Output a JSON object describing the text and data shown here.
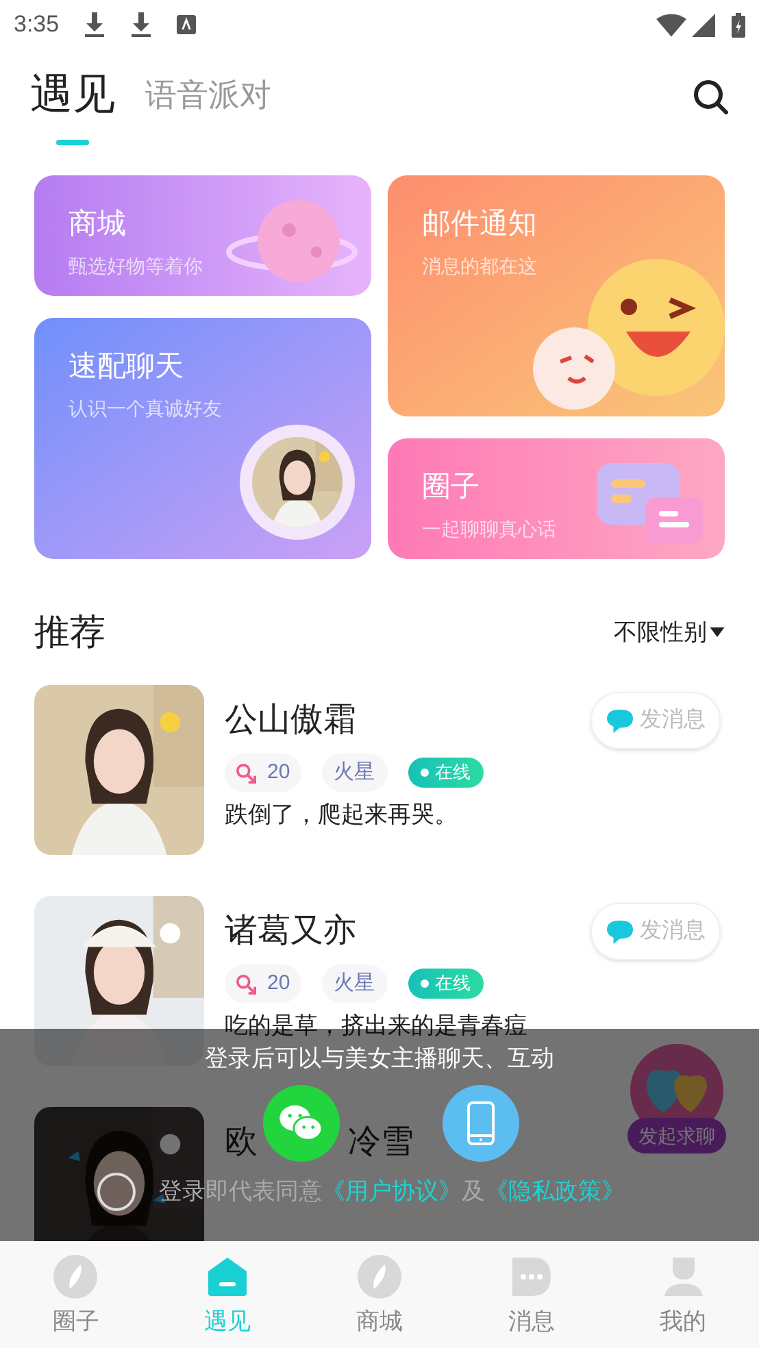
{
  "status_bar": {
    "time": "3:35"
  },
  "header": {
    "tabs": [
      {
        "label": "遇见",
        "selected": true
      },
      {
        "label": "语音派对",
        "selected": false
      }
    ]
  },
  "feature_cards": [
    {
      "kind": "shop",
      "title": "商城",
      "subtitle": "甄选好物等着你"
    },
    {
      "kind": "match",
      "title": "速配聊天",
      "subtitle": "认识一个真诚好友"
    },
    {
      "kind": "mail",
      "title": "邮件通知",
      "subtitle": "消息的都在这"
    },
    {
      "kind": "circle",
      "title": "圈子",
      "subtitle": "一起聊聊真心话"
    }
  ],
  "recommend": {
    "title": "推荐",
    "filter": "不限性别"
  },
  "users": [
    {
      "name": "公山傲霜",
      "age": "20",
      "place": "火星",
      "status": "在线",
      "bio": "跌倒了，爬起来再哭。",
      "message": "发消息"
    },
    {
      "name": "诸葛又亦",
      "age": "20",
      "place": "火星",
      "status": "在线",
      "bio": "吃的是草，挤出来的是青春痘",
      "message": "发消息"
    },
    {
      "kind": "partial",
      "name_parts": [
        "欧",
        "冷雪"
      ]
    }
  ],
  "floating_button": {
    "label": "发起求聊"
  },
  "login_overlay": {
    "title": "登录后可以与美女主播聊天、互动",
    "agree_checked": false,
    "agreement": {
      "text": "登录即代表同意",
      "link1": "《用户协议》",
      "joiner": "及",
      "link2": "《隐私政策》"
    }
  },
  "bottom_nav": [
    {
      "label": "圈子",
      "selected": false,
      "kind": "compass"
    },
    {
      "label": "遇见",
      "selected": true,
      "kind": "home"
    },
    {
      "label": "商城",
      "selected": false,
      "kind": "compass"
    },
    {
      "label": "消息",
      "selected": false,
      "kind": "chat"
    },
    {
      "label": "我的",
      "selected": false,
      "kind": "person"
    }
  ]
}
